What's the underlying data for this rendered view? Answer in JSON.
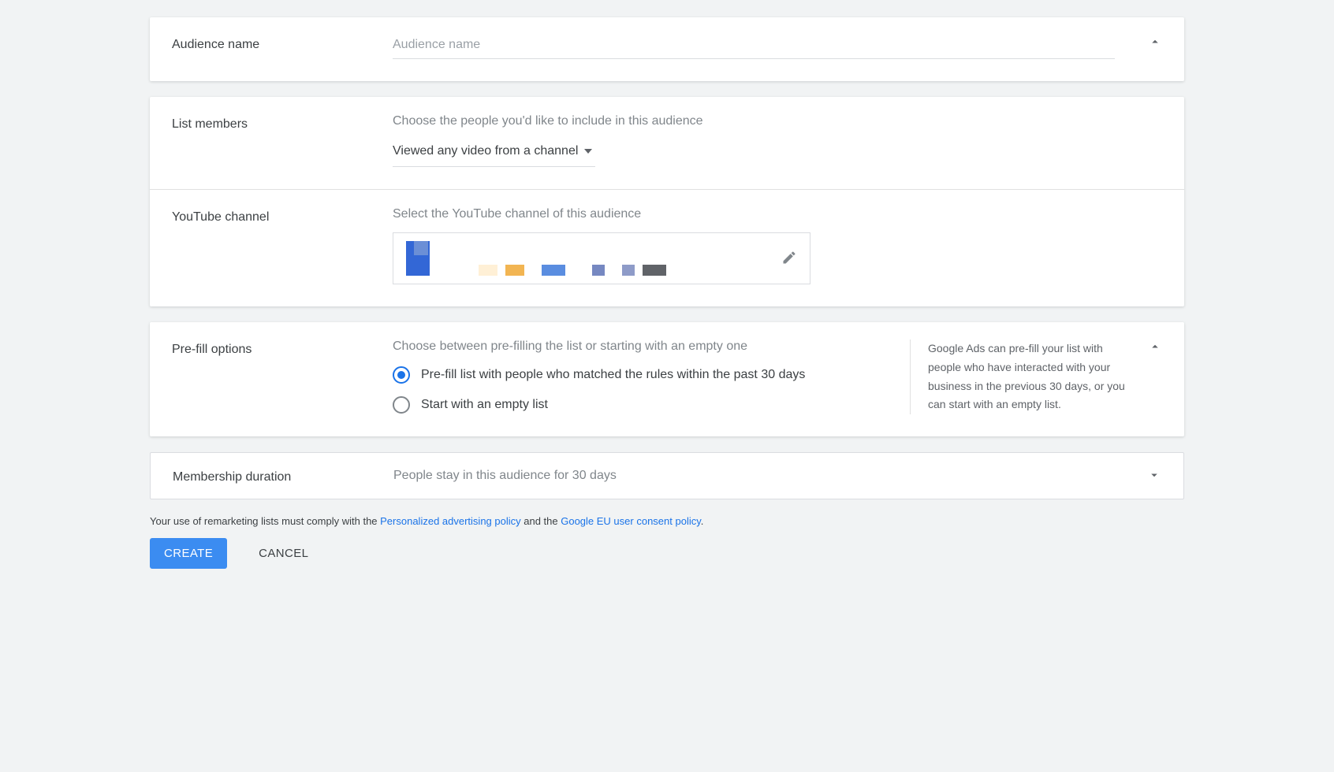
{
  "audience_name": {
    "label": "Audience name",
    "placeholder": "Audience name",
    "value": ""
  },
  "list_members": {
    "label": "List members",
    "desc": "Choose the people you'd like to include in this audience",
    "selected": "Viewed any video from a channel"
  },
  "youtube_channel": {
    "label": "YouTube channel",
    "desc": "Select the YouTube channel of this audience",
    "selected_channel": "(redacted)"
  },
  "prefill": {
    "label": "Pre-fill options",
    "desc": "Choose between pre-filling the list or starting with an empty one",
    "options": [
      {
        "label": "Pre-fill list with people who matched the rules within the past 30 days",
        "checked": true
      },
      {
        "label": "Start with an empty list",
        "checked": false
      }
    ],
    "help": "Google Ads can pre-fill your list with people who have interacted with your business in the previous 30 days, or you can start with an empty list."
  },
  "membership": {
    "label": "Membership duration",
    "summary": "People stay in this audience for 30 days"
  },
  "compliance": {
    "prefix": "Your use of remarketing lists must comply with the ",
    "policy1": "Personalized advertising policy",
    "mid": " and the ",
    "policy2": "Google EU user consent policy",
    "suffix": "."
  },
  "actions": {
    "create": "CREATE",
    "cancel": "CANCEL"
  }
}
